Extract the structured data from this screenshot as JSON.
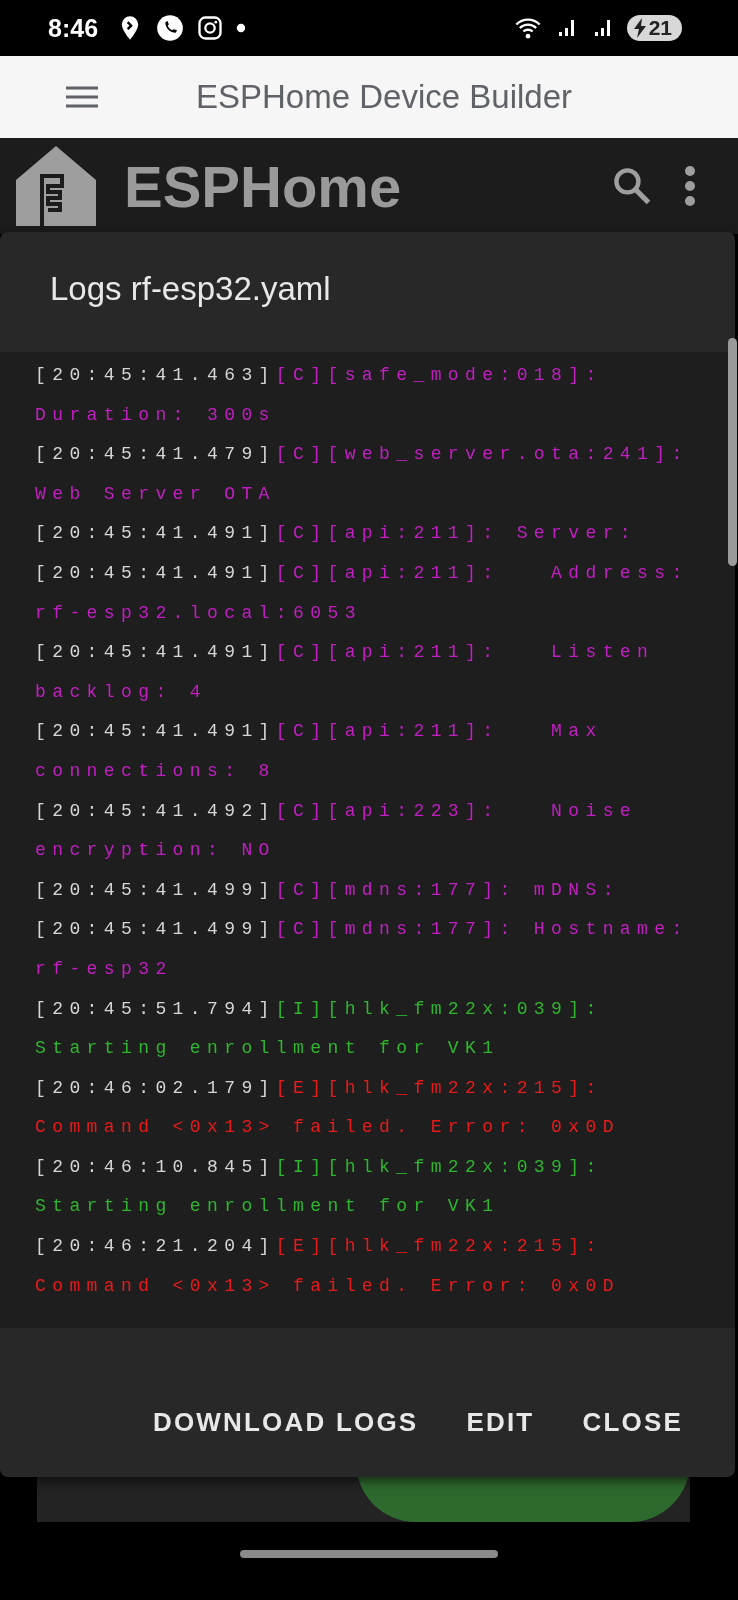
{
  "status_bar": {
    "time": "8:46",
    "battery": "21"
  },
  "app_bar": {
    "title": "ESPHome Device Builder"
  },
  "header": {
    "brand": "ESPHome"
  },
  "dialog": {
    "title": "Logs rf-esp32.yaml",
    "log": [
      {
        "time": "[20:45:41.463]",
        "kind": "config",
        "message": "[C][safe_mode:018]: Duration: 300s"
      },
      {
        "time": "[20:45:41.479]",
        "kind": "config",
        "message": "[C][web_server.ota:241]: Web Server OTA"
      },
      {
        "time": "[20:45:41.491]",
        "kind": "config",
        "message": "[C][api:211]: Server:"
      },
      {
        "time": "[20:45:41.491]",
        "kind": "config",
        "message": "[C][api:211]:   Address: rf-esp32.local:6053"
      },
      {
        "time": "[20:45:41.491]",
        "kind": "config",
        "message": "[C][api:211]:   Listen backlog: 4"
      },
      {
        "time": "[20:45:41.491]",
        "kind": "config",
        "message": "[C][api:211]:   Max connections: 8"
      },
      {
        "time": "[20:45:41.492]",
        "kind": "config",
        "message": "[C][api:223]:   Noise encryption: NO"
      },
      {
        "time": "[20:45:41.499]",
        "kind": "config",
        "message": "[C][mdns:177]: mDNS:"
      },
      {
        "time": "[20:45:41.499]",
        "kind": "config",
        "message": "[C][mdns:177]: Hostname: rf-esp32"
      },
      {
        "time": "[20:45:51.794]",
        "kind": "info",
        "message": "[I][hlk_fm22x:039]: Starting enrollment for VK1"
      },
      {
        "time": "[20:46:02.179]",
        "kind": "error",
        "message": "[E][hlk_fm22x:215]: Command <0x13> failed. Error: 0x0D"
      },
      {
        "time": "[20:46:10.845]",
        "kind": "info",
        "message": "[I][hlk_fm22x:039]: Starting enrollment for VK1"
      },
      {
        "time": "[20:46:21.204]",
        "kind": "error",
        "message": "[E][hlk_fm22x:215]: Command <0x13> failed. Error: 0x0D"
      }
    ],
    "buttons": [
      "DOWNLOAD LOGS",
      "EDIT",
      "CLOSE"
    ]
  }
}
